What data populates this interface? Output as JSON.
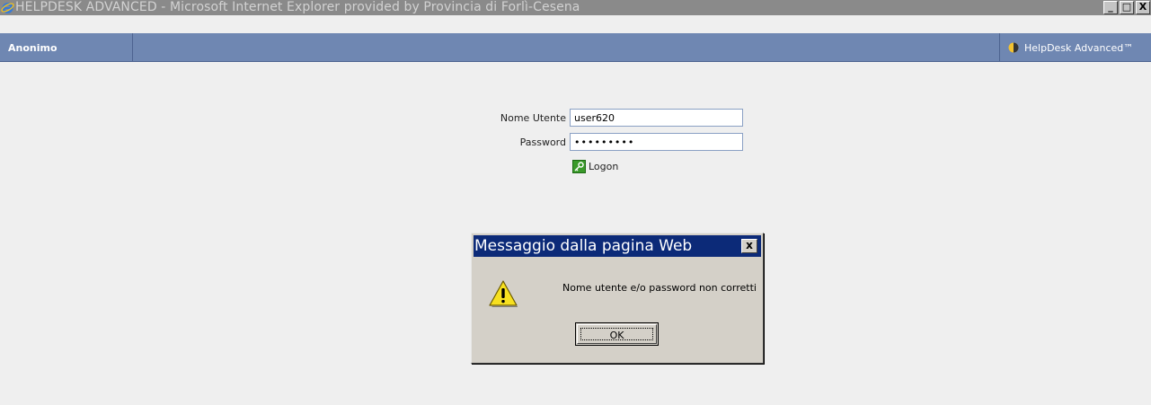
{
  "window": {
    "title": "HELPDESK ADVANCED - Microsoft Internet Explorer provided by Provincia di Forlì-Cesena",
    "minimize_label": "_",
    "maximize_label": "□",
    "close_label": "X"
  },
  "appbar": {
    "user": "Anonimo",
    "brand": "HelpDesk Advanced™"
  },
  "login": {
    "username_label": "Nome Utente",
    "username_value": "user620",
    "password_label": "Password",
    "password_value": "•••••••••",
    "logon_label": "Logon"
  },
  "dialog": {
    "title": "Messaggio dalla pagina Web",
    "close_label": "x",
    "message": "Nome utente e/o password non corretti",
    "ok_label": "OK"
  },
  "colors": {
    "appbar": "#6f87b2",
    "titlebar_inactive": "#8a8a8a",
    "dialog_title": "#0c2a78"
  }
}
